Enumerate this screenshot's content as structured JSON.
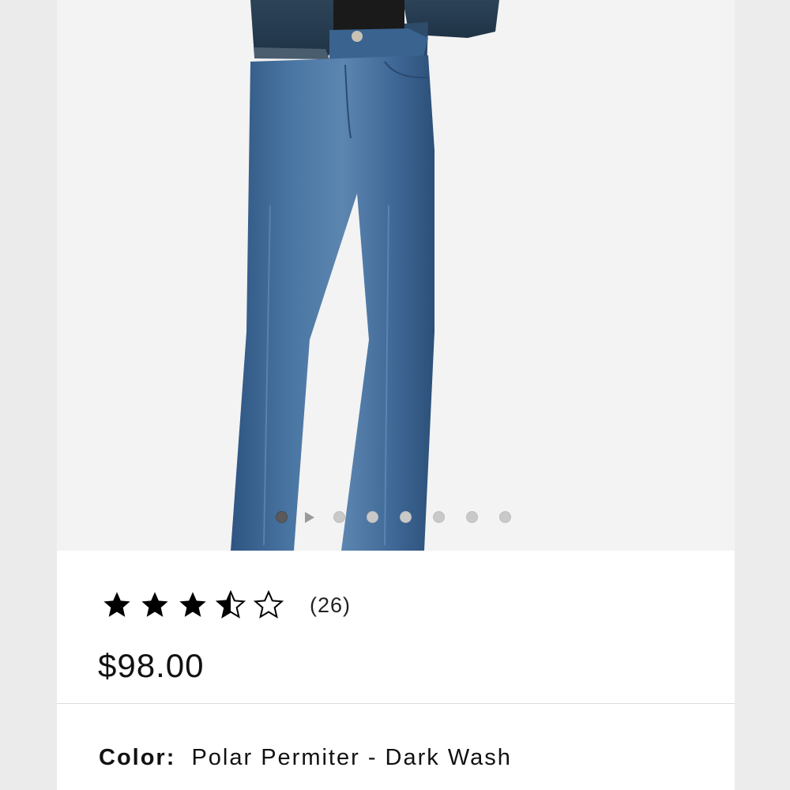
{
  "product": {
    "gallery": {
      "image_name": "jeans-product-photo",
      "slide_count": 8,
      "active_slide": 1,
      "has_video": true
    },
    "rating": {
      "value": 3.5,
      "max": 5,
      "review_count_label": "(26)"
    },
    "price": "$98.00",
    "color": {
      "label": "Color:",
      "value": "Polar Permiter - Dark Wash"
    }
  },
  "colors": {
    "denim": "#3d6390",
    "denim_dark": "#2b4a70",
    "star": "#000000"
  }
}
